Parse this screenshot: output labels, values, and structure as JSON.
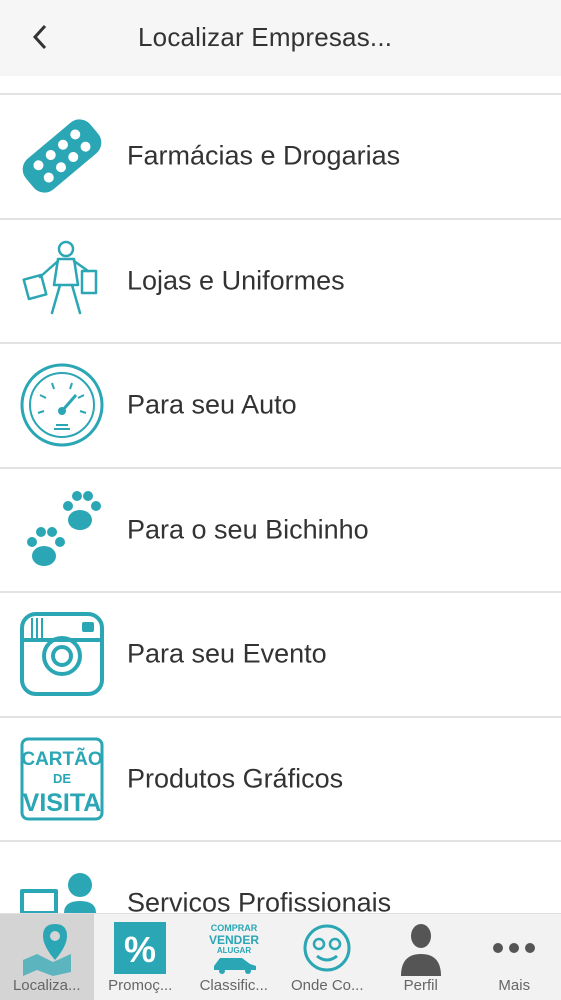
{
  "header": {
    "title": "Localizar Empresas..."
  },
  "colors": {
    "accent": "#2aa6b5",
    "text": "#333333",
    "divider": "#e2e2e2"
  },
  "categories": [
    {
      "label": "Farmácias e Drogarias",
      "icon": "pill-pack-icon"
    },
    {
      "label": "Lojas e Uniformes",
      "icon": "shopper-icon"
    },
    {
      "label": "Para seu Auto",
      "icon": "speedometer-icon"
    },
    {
      "label": "Para o seu Bichinho",
      "icon": "paw-icon"
    },
    {
      "label": "Para seu Evento",
      "icon": "camera-icon"
    },
    {
      "label": "Produtos Gráficos",
      "icon": "business-card-icon",
      "icon_text": [
        "CARTÃO",
        "DE",
        "VISITA"
      ]
    },
    {
      "label": "Servicos Profissionais",
      "icon": "professional-icon"
    }
  ],
  "tabs": [
    {
      "label": "Localiza...",
      "icon": "map-pin-icon",
      "active": true
    },
    {
      "label": "Promoç...",
      "icon": "percent-icon"
    },
    {
      "label": "Classific...",
      "icon": "classifieds-icon",
      "icon_text": [
        "COMPRAR",
        "VENDER",
        "ALUGAR"
      ]
    },
    {
      "label": "Onde Co...",
      "icon": "smiley-face-icon"
    },
    {
      "label": "Perfil",
      "icon": "person-icon"
    },
    {
      "label": "Mais",
      "icon": "more-dots-icon"
    }
  ]
}
